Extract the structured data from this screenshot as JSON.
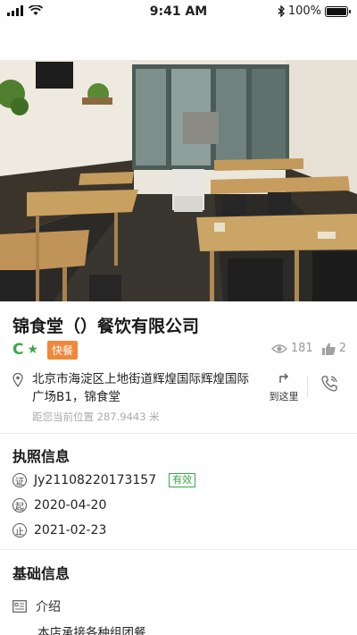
{
  "status_bar": {
    "time": "9:41 AM",
    "battery": "100%",
    "battery_level": 1.0,
    "icons": [
      "signal-icon",
      "wifi-icon",
      "bluetooth-icon",
      "battery-icon"
    ]
  },
  "store": {
    "name": "锦食堂（）餐饮有限公司",
    "grade": "C",
    "category_tag": "快餐",
    "views": "181",
    "likes": "2",
    "address": "北京市海淀区上地街道辉煌国际辉煌国际广场B1，锦食堂",
    "distance": "距您当前位置 287.9443 米",
    "navigate_label": "到这里"
  },
  "license": {
    "section_title": "执照信息",
    "number_marker": "证",
    "number": "Jy21108220173157",
    "status": "有效",
    "start_marker": "起",
    "start_date": "2020-04-20",
    "end_marker": "止",
    "end_date": "2021-02-23"
  },
  "basic": {
    "section_title": "基础信息",
    "intro_label": "介绍",
    "intro_text": "本店承接各种组团餐"
  },
  "colors": {
    "grade_green": "#3aa845",
    "tag_orange": "#f0883a"
  }
}
